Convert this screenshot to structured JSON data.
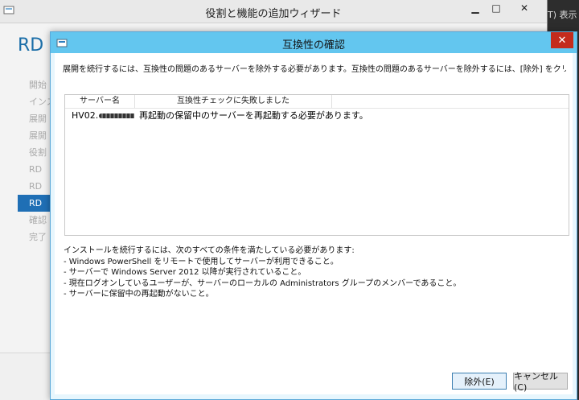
{
  "background_window": {
    "title": "役割と機能の追加ウィザード",
    "heading": "RD",
    "steps": [
      "開始",
      "インス",
      "展開",
      "展開",
      "役割",
      "RD",
      "RD",
      "RD",
      "確認",
      "完了"
    ],
    "active_step_index": 7,
    "controls": {
      "minimize": "▁",
      "maximize": "□",
      "close": "✕"
    }
  },
  "right_strip": {
    "text": "T)  表示"
  },
  "dialog": {
    "title": "互換性の確認",
    "close_glyph": "✕",
    "intro": "展開を続行するには、互換性の問題のあるサーバーを除外する必要があります。互換性の問題のあるサーバーを除外するには、[除外] をクリックします。",
    "columns": [
      "サーバー名",
      "互換性チェックに失敗しました",
      ""
    ],
    "rows": [
      {
        "server": "HV02.",
        "reason": "再起動の保留中のサーバーを再起動する必要があります。"
      }
    ],
    "conditions": [
      "インストールを続行するには、次のすべての条件を満たしている必要があります:",
      "- Windows PowerShell をリモートで使用してサーバーが利用できること。",
      "- サーバーで Windows Server 2012 以降が実行されていること。",
      "- 現在ログオンしているユーザーが、サーバーのローカルの Administrators グループのメンバーであること。",
      "- サーバーに保留中の再起動がないこと。"
    ],
    "buttons": {
      "remove": "除外(E)",
      "cancel": "キャンセル(C)"
    }
  },
  "colors": {
    "dialog_titlebar": "#63c6ef",
    "dialog_frame": "#e7f6fd",
    "close_button": "#c42b1c",
    "active_step": "#1f6fb5",
    "heading": "#1b6ea8"
  }
}
